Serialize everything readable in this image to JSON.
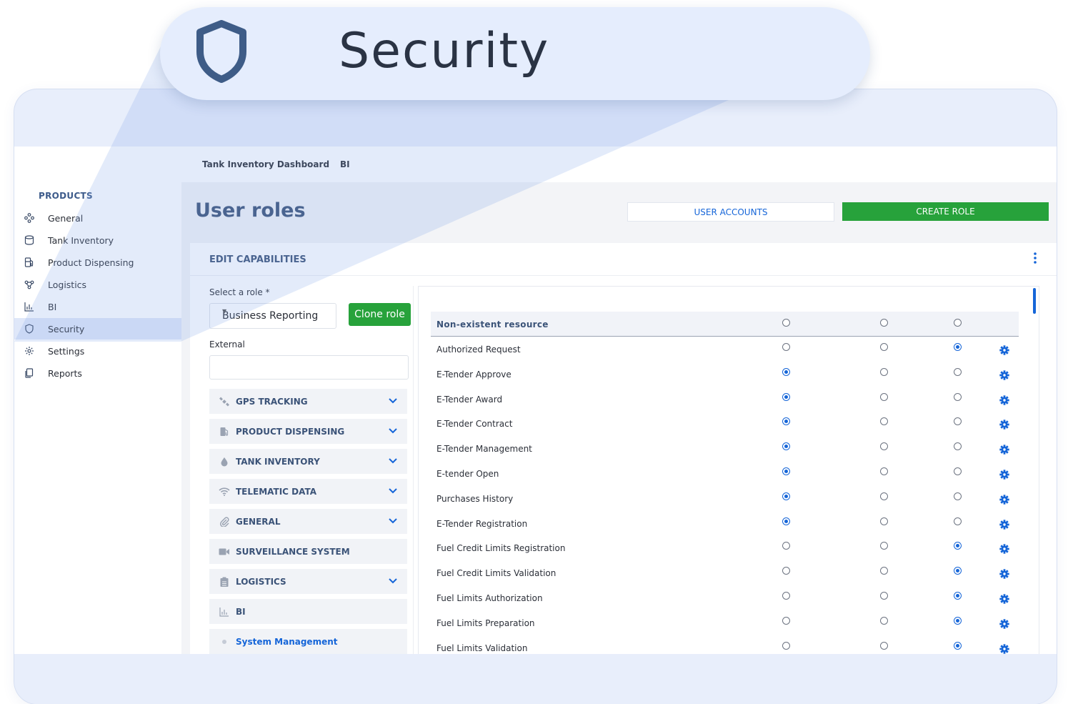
{
  "callout": {
    "icon": "shield-icon",
    "title": "Security"
  },
  "topnav": {
    "links": [
      "Tank Inventory Dashboard",
      "BI"
    ]
  },
  "sidebar": {
    "heading": "PRODUCTS",
    "items": [
      {
        "label": "General",
        "icon": "general-icon"
      },
      {
        "label": "Tank Inventory",
        "icon": "cylinder-icon"
      },
      {
        "label": "Product Dispensing",
        "icon": "fuel-pump-icon"
      },
      {
        "label": "Logistics",
        "icon": "route-icon"
      },
      {
        "label": "BI",
        "icon": "bar-chart-icon"
      },
      {
        "label": "Security",
        "icon": "shield-icon",
        "active": true
      },
      {
        "label": "Settings",
        "icon": "gear-icon"
      },
      {
        "label": "Reports",
        "icon": "documents-icon"
      }
    ]
  },
  "main": {
    "title": "User roles",
    "user_accounts_label": "USER ACCOUNTS",
    "create_role_label": "CREATE ROLE"
  },
  "card": {
    "title": "EDIT CAPABILITIES",
    "select_label": "Select a role *",
    "selected_role": "Business Reporting",
    "clone_label": "Clone role",
    "external_label": "External",
    "external_value": "",
    "accordions": [
      {
        "label": "GPS TRACKING",
        "icon": "satellite-icon",
        "expandable": true
      },
      {
        "label": "PRODUCT DISPENSING",
        "icon": "fuel-pump-icon",
        "expandable": true
      },
      {
        "label": "TANK INVENTORY",
        "icon": "drop-icon",
        "expandable": true
      },
      {
        "label": "TELEMATIC DATA",
        "icon": "wifi-icon",
        "expandable": true
      },
      {
        "label": "GENERAL",
        "icon": "paperclip-icon",
        "expandable": true
      },
      {
        "label": "SURVEILLANCE SYSTEM",
        "icon": "video-camera-icon",
        "expandable": false
      },
      {
        "label": "LOGISTICS",
        "icon": "clipboard-icon",
        "expandable": true
      },
      {
        "label": "BI",
        "icon": "bar-chart-icon",
        "expandable": false
      },
      {
        "label": "System Management",
        "icon": "dot-icon",
        "expandable": false
      }
    ]
  },
  "permissions": {
    "header": {
      "name": "Non-existent resource",
      "selected": -1
    },
    "rows": [
      {
        "name": "Authorized Request",
        "selected": 2
      },
      {
        "name": "E-Tender Approve",
        "selected": 0
      },
      {
        "name": "E-Tender Award",
        "selected": 0
      },
      {
        "name": "E-Tender Contract",
        "selected": 0
      },
      {
        "name": "E-Tender Management",
        "selected": 0
      },
      {
        "name": "E-tender Open",
        "selected": 0
      },
      {
        "name": "Purchases History",
        "selected": 0
      },
      {
        "name": "E-Tender Registration",
        "selected": 0
      },
      {
        "name": "Fuel Credit Limits Registration",
        "selected": 2
      },
      {
        "name": "Fuel Credit Limits Validation",
        "selected": 2
      },
      {
        "name": "Fuel Limits Authorization",
        "selected": 2
      },
      {
        "name": "Fuel Limits Preparation",
        "selected": 2
      },
      {
        "name": "Fuel Limits Validation",
        "selected": 2
      }
    ]
  },
  "colors": {
    "accent": "#1565d8",
    "success": "#27a23b",
    "heading": "#3b5378"
  }
}
